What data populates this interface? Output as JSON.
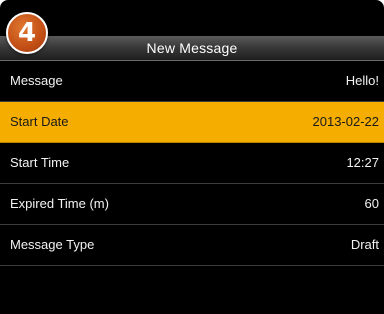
{
  "step_badge": {
    "number": "4",
    "color": "#c7561a"
  },
  "header": {
    "title": "New Message"
  },
  "menu": {
    "items": [
      {
        "label": "Message",
        "value": "Hello!",
        "selected": false
      },
      {
        "label": "Start Date",
        "value": "2013-02-22",
        "selected": true
      },
      {
        "label": "Start Time",
        "value": "12:27",
        "selected": false
      },
      {
        "label": "Expired Time (m)",
        "value": "60",
        "selected": false
      },
      {
        "label": "Message Type",
        "value": "Draft",
        "selected": false
      }
    ]
  },
  "colors": {
    "background": "#000000",
    "selected_highlight": "#f5ad00",
    "text": "#f2f2f2",
    "separator": "#3c3c3c"
  }
}
